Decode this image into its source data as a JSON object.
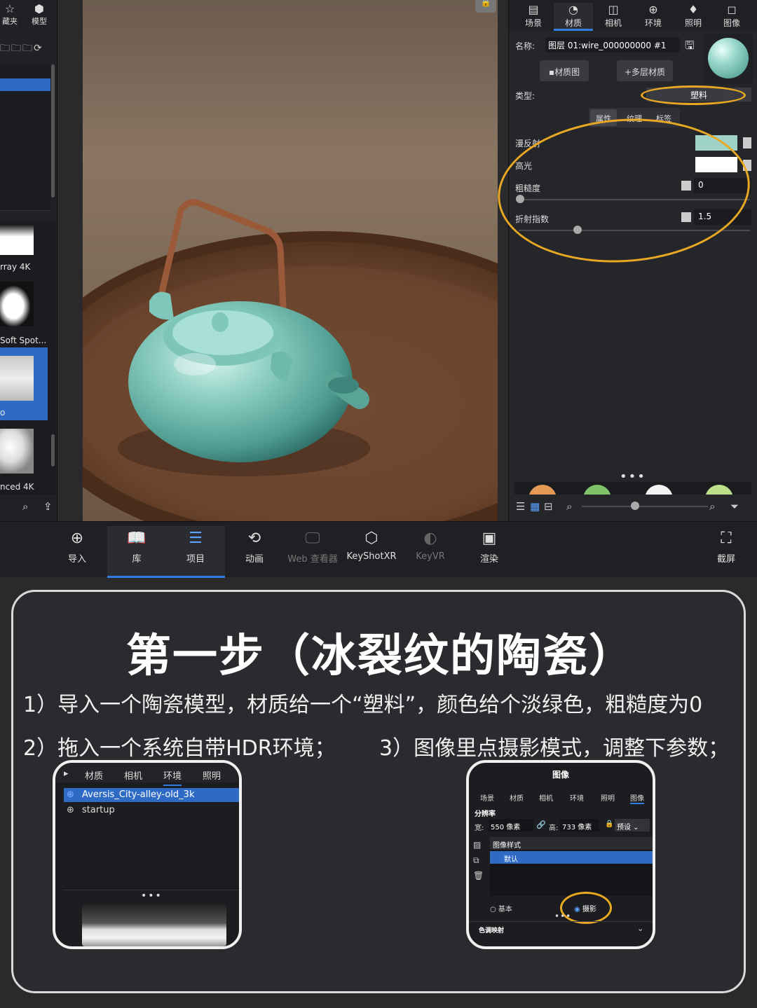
{
  "left_panel": {
    "tabs": [
      {
        "label": "藏夹",
        "icon": "star-icon"
      },
      {
        "label": "模型",
        "icon": "cubes-icon"
      }
    ],
    "tiles": [
      {
        "label": "rray 4K"
      },
      {
        "label": "Soft Spot..."
      },
      {
        "label": "o"
      },
      {
        "label": "nced 4K"
      }
    ]
  },
  "right_panel": {
    "tabs": [
      {
        "label": "场景",
        "icon": "scene-icon"
      },
      {
        "label": "材质",
        "icon": "material-icon"
      },
      {
        "label": "相机",
        "icon": "camera-icon"
      },
      {
        "label": "环境",
        "icon": "globe-icon"
      },
      {
        "label": "照明",
        "icon": "bulb-icon"
      },
      {
        "label": "图像",
        "icon": "image-icon"
      }
    ],
    "name_label": "名称:",
    "name_value": "图层 01:wire_000000000 #1",
    "material_graph_btn": "材质图",
    "multi_material_btn": "多层材质",
    "type_label": "类型:",
    "type_value": "塑料",
    "sub_tabs": [
      "属性",
      "纹理",
      "标签"
    ],
    "props": [
      {
        "label": "漫反射"
      },
      {
        "label": "高光"
      },
      {
        "label": "粗糙度",
        "value": "0"
      },
      {
        "label": "折射指数",
        "value": "1.5"
      }
    ],
    "colors": {
      "diffuse": "#9fd3c7",
      "specular": "#ffffff",
      "highlight": "#e8a823"
    }
  },
  "toolbar": {
    "items": [
      {
        "label": "导入",
        "icon": "import-icon"
      },
      {
        "label": "库",
        "icon": "book-icon"
      },
      {
        "label": "项目",
        "icon": "list-icon"
      },
      {
        "label": "动画",
        "icon": "animation-icon"
      },
      {
        "label": "Web 查看器",
        "icon": "monitor-icon"
      },
      {
        "label": "KeyShotXR",
        "icon": "xr-icon"
      },
      {
        "label": "KeyVR",
        "icon": "vr-icon"
      },
      {
        "label": "渲染",
        "icon": "render-icon"
      },
      {
        "label": "截屏",
        "icon": "screenshot-icon"
      }
    ]
  },
  "card": {
    "title": "第一步（冰裂纹的陶瓷）",
    "step1": "1）导入一个陶瓷模型，材质给一个“塑料”，颜色给个淡绿色，粗糙度为0",
    "step2": "2）拖入一个系统自带HDR环境；",
    "step3": "3）图像里点摄影模式，调整下参数；"
  },
  "env_shot": {
    "tabs": [
      "材质",
      "相机",
      "环境",
      "照明"
    ],
    "items": [
      "Aversis_City-alley-old_3k",
      "startup"
    ]
  },
  "image_shot": {
    "header": "图像",
    "tabs": [
      "场景",
      "材质",
      "相机",
      "环境",
      "照明",
      "图像"
    ],
    "resolution_label": "分辨率",
    "width_label": "宽:",
    "width_value": "550 像素",
    "height_label": "高:",
    "height_value": "733 像素",
    "preset": "预设",
    "style_label": "图像样式",
    "style_value": "默认",
    "mode_basic": "基本",
    "mode_photo": "摄影",
    "tone_label": "色调映射"
  }
}
